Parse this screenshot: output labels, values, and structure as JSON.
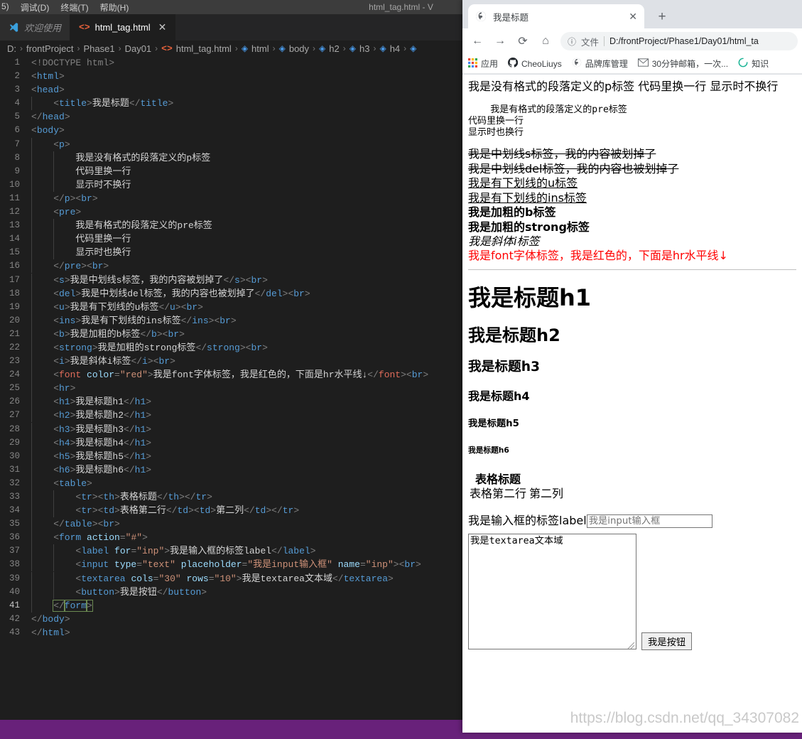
{
  "vscode": {
    "window_title": "html_tag.html - V",
    "menu": [
      "5)",
      "调试(D)",
      "终端(T)",
      "帮助(H)"
    ],
    "tabs": [
      {
        "label": "欢迎使用",
        "icon": "vscode-logo-icon",
        "active": false,
        "closable": false
      },
      {
        "label": "html_tag.html",
        "icon": "html-file-icon",
        "active": true,
        "closable": true,
        "close_glyph": "✕"
      }
    ],
    "breadcrumb": [
      {
        "label": "D:",
        "icon": ""
      },
      {
        "label": "frontProject",
        "icon": ""
      },
      {
        "label": "Phase1",
        "icon": ""
      },
      {
        "label": "Day01",
        "icon": ""
      },
      {
        "label": "html_tag.html",
        "icon": "html-tag-icon"
      },
      {
        "label": "html",
        "icon": "symbol-cube-icon"
      },
      {
        "label": "body",
        "icon": "symbol-cube-icon"
      },
      {
        "label": "h2",
        "icon": "symbol-cube-icon"
      },
      {
        "label": "h3",
        "icon": "symbol-cube-icon"
      },
      {
        "label": "h4",
        "icon": "symbol-cube-icon"
      },
      {
        "label": "",
        "icon": "symbol-cube-icon"
      }
    ],
    "code_lines": [
      {
        "n": 1,
        "indent": 0,
        "html": "<span class='punc'>&lt;!</span><span class='doctype'>DOCTYPE html</span><span class='punc'>&gt;</span>"
      },
      {
        "n": 2,
        "indent": 0,
        "html": "<span class='punc'>&lt;</span><span class='tagname'>html</span><span class='punc'>&gt;</span>"
      },
      {
        "n": 3,
        "indent": 0,
        "html": "<span class='punc'>&lt;</span><span class='tagname'>head</span><span class='punc'>&gt;</span>"
      },
      {
        "n": 4,
        "indent": 1,
        "html": "<span class='punc'>&lt;</span><span class='tagname'>title</span><span class='punc'>&gt;</span><span class='txt'>我是标题</span><span class='punc'>&lt;/</span><span class='tagname'>title</span><span class='punc'>&gt;</span>"
      },
      {
        "n": 5,
        "indent": 0,
        "html": "<span class='punc'>&lt;/</span><span class='tagname'>head</span><span class='punc'>&gt;</span>"
      },
      {
        "n": 6,
        "indent": 0,
        "html": "<span class='punc'>&lt;</span><span class='tagname'>body</span><span class='punc'>&gt;</span>"
      },
      {
        "n": 7,
        "indent": 1,
        "html": "<span class='punc'>&lt;</span><span class='tagname'>p</span><span class='punc'>&gt;</span>"
      },
      {
        "n": 8,
        "indent": 2,
        "html": "<span class='txt'>我是没有格式的段落定义的p标签</span>"
      },
      {
        "n": 9,
        "indent": 2,
        "html": "<span class='txt'>代码里换一行</span>"
      },
      {
        "n": 10,
        "indent": 2,
        "html": "<span class='txt'>显示时不换行</span>"
      },
      {
        "n": 11,
        "indent": 1,
        "html": "<span class='punc'>&lt;/</span><span class='tagname'>p</span><span class='punc'>&gt;&lt;</span><span class='tagname'>br</span><span class='punc'>&gt;</span>"
      },
      {
        "n": 12,
        "indent": 1,
        "html": "<span class='punc'>&lt;</span><span class='tagname'>pre</span><span class='punc'>&gt;</span>"
      },
      {
        "n": 13,
        "indent": 2,
        "html": "<span class='txt'>我是有格式的段落定义的pre标签</span>"
      },
      {
        "n": 14,
        "indent": 2,
        "html": "<span class='txt'>代码里换一行</span>"
      },
      {
        "n": 15,
        "indent": 2,
        "html": "<span class='txt'>显示时也换行</span>"
      },
      {
        "n": 16,
        "indent": 1,
        "html": "<span class='punc'>&lt;/</span><span class='tagname'>pre</span><span class='punc'>&gt;&lt;</span><span class='tagname'>br</span><span class='punc'>&gt;</span>"
      },
      {
        "n": 17,
        "indent": 1,
        "html": "<span class='punc'>&lt;</span><span class='tagname'>s</span><span class='punc'>&gt;</span><span class='txt'>我是中划线s标签，我的内容被划掉了</span><span class='punc'>&lt;/</span><span class='tagname'>s</span><span class='punc'>&gt;&lt;</span><span class='tagname'>br</span><span class='punc'>&gt;</span>"
      },
      {
        "n": 18,
        "indent": 1,
        "html": "<span class='punc'>&lt;</span><span class='tagname'>del</span><span class='punc'>&gt;</span><span class='txt'>我是中划线del标签，我的内容也被划掉了</span><span class='punc'>&lt;/</span><span class='tagname'>del</span><span class='punc'>&gt;&lt;</span><span class='tagname'>br</span><span class='punc'>&gt;</span>"
      },
      {
        "n": 19,
        "indent": 1,
        "html": "<span class='punc'>&lt;</span><span class='tagname'>u</span><span class='punc'>&gt;</span><span class='txt'>我是有下划线的u标签</span><span class='punc'>&lt;/</span><span class='tagname'>u</span><span class='punc'>&gt;&lt;</span><span class='tagname'>br</span><span class='punc'>&gt;</span>"
      },
      {
        "n": 20,
        "indent": 1,
        "html": "<span class='punc'>&lt;</span><span class='tagname'>ins</span><span class='punc'>&gt;</span><span class='txt'>我是有下划线的ins标签</span><span class='punc'>&lt;/</span><span class='tagname'>ins</span><span class='punc'>&gt;&lt;</span><span class='tagname'>br</span><span class='punc'>&gt;</span>"
      },
      {
        "n": 21,
        "indent": 1,
        "html": "<span class='punc'>&lt;</span><span class='tagname'>b</span><span class='punc'>&gt;</span><span class='txt'>我是加粗的b标签</span><span class='punc'>&lt;/</span><span class='tagname'>b</span><span class='punc'>&gt;&lt;</span><span class='tagname'>br</span><span class='punc'>&gt;</span>"
      },
      {
        "n": 22,
        "indent": 1,
        "html": "<span class='punc'>&lt;</span><span class='tagname'>strong</span><span class='punc'>&gt;</span><span class='txt'>我是加粗的strong标签</span><span class='punc'>&lt;/</span><span class='tagname'>strong</span><span class='punc'>&gt;&lt;</span><span class='tagname'>br</span><span class='punc'>&gt;</span>"
      },
      {
        "n": 23,
        "indent": 1,
        "html": "<span class='punc'>&lt;</span><span class='tagname'>i</span><span class='punc'>&gt;</span><span class='txt'>我是斜体i标签</span><span class='punc'>&lt;/</span><span class='tagname'>i</span><span class='punc'>&gt;&lt;</span><span class='tagname'>br</span><span class='punc'>&gt;</span>"
      },
      {
        "n": 24,
        "indent": 1,
        "html": "<span class='punc'>&lt;</span><span class='fonttag'>font</span> <span class='attr'>color</span><span class='punc'>=</span><span class='str'>\"red\"</span><span class='punc'>&gt;</span><span class='txt'>我是font字体标签，我是红色的，下面是hr水平线↓</span><span class='punc'>&lt;/</span><span class='fonttag'>font</span><span class='punc'>&gt;&lt;</span><span class='tagname'>br</span><span class='punc'>&gt;</span>"
      },
      {
        "n": 25,
        "indent": 1,
        "html": "<span class='punc'>&lt;</span><span class='tagname'>hr</span><span class='punc'>&gt;</span>"
      },
      {
        "n": 26,
        "indent": 1,
        "html": "<span class='punc'>&lt;</span><span class='tagname'>h1</span><span class='punc'>&gt;</span><span class='txt'>我是标题h1</span><span class='punc'>&lt;/</span><span class='tagname'>h1</span><span class='punc'>&gt;</span>"
      },
      {
        "n": 27,
        "indent": 1,
        "html": "<span class='punc'>&lt;</span><span class='tagname'>h2</span><span class='punc'>&gt;</span><span class='txt'>我是标题h2</span><span class='punc'>&lt;/</span><span class='tagname'>h1</span><span class='punc'>&gt;</span>"
      },
      {
        "n": 28,
        "indent": 1,
        "html": "<span class='punc'>&lt;</span><span class='tagname'>h3</span><span class='punc'>&gt;</span><span class='txt'>我是标题h3</span><span class='punc'>&lt;/</span><span class='tagname'>h1</span><span class='punc'>&gt;</span>"
      },
      {
        "n": 29,
        "indent": 1,
        "html": "<span class='punc'>&lt;</span><span class='tagname'>h4</span><span class='punc'>&gt;</span><span class='txt'>我是标题h4</span><span class='punc'>&lt;/</span><span class='tagname'>h1</span><span class='punc'>&gt;</span>"
      },
      {
        "n": 30,
        "indent": 1,
        "html": "<span class='punc'>&lt;</span><span class='tagname'>h5</span><span class='punc'>&gt;</span><span class='txt'>我是标题h5</span><span class='punc'>&lt;/</span><span class='tagname'>h1</span><span class='punc'>&gt;</span>"
      },
      {
        "n": 31,
        "indent": 1,
        "html": "<span class='punc'>&lt;</span><span class='tagname'>h6</span><span class='punc'>&gt;</span><span class='txt'>我是标题h6</span><span class='punc'>&lt;/</span><span class='tagname'>h1</span><span class='punc'>&gt;</span>"
      },
      {
        "n": 32,
        "indent": 1,
        "html": "<span class='punc'>&lt;</span><span class='tagname'>table</span><span class='punc'>&gt;</span>"
      },
      {
        "n": 33,
        "indent": 2,
        "html": "<span class='punc'>&lt;</span><span class='tagname'>tr</span><span class='punc'>&gt;&lt;</span><span class='tagname'>th</span><span class='punc'>&gt;</span><span class='txt'>表格标题</span><span class='punc'>&lt;/</span><span class='tagname'>th</span><span class='punc'>&gt;&lt;/</span><span class='tagname'>tr</span><span class='punc'>&gt;</span>"
      },
      {
        "n": 34,
        "indent": 2,
        "html": "<span class='punc'>&lt;</span><span class='tagname'>tr</span><span class='punc'>&gt;&lt;</span><span class='tagname'>td</span><span class='punc'>&gt;</span><span class='txt'>表格第二行</span><span class='punc'>&lt;/</span><span class='tagname'>td</span><span class='punc'>&gt;&lt;</span><span class='tagname'>td</span><span class='punc'>&gt;</span><span class='txt'>第二列</span><span class='punc'>&lt;/</span><span class='tagname'>td</span><span class='punc'>&gt;&lt;/</span><span class='tagname'>tr</span><span class='punc'>&gt;</span>"
      },
      {
        "n": 35,
        "indent": 1,
        "html": "<span class='punc'>&lt;/</span><span class='tagname'>table</span><span class='punc'>&gt;&lt;</span><span class='tagname'>br</span><span class='punc'>&gt;</span>"
      },
      {
        "n": 36,
        "indent": 1,
        "html": "<span class='punc'>&lt;</span><span class='tagname'>form</span> <span class='attr'>action</span><span class='punc'>=</span><span class='str'>\"#\"</span><span class='punc'>&gt;</span>"
      },
      {
        "n": 37,
        "indent": 2,
        "html": "<span class='punc'>&lt;</span><span class='tagname'>label</span> <span class='attr'>for</span><span class='punc'>=</span><span class='str'>\"inp\"</span><span class='punc'>&gt;</span><span class='txt'>我是输入框的标签label</span><span class='punc'>&lt;/</span><span class='tagname'>label</span><span class='punc'>&gt;</span>"
      },
      {
        "n": 38,
        "indent": 2,
        "html": "<span class='punc'>&lt;</span><span class='tagname'>input</span> <span class='attr'>type</span><span class='punc'>=</span><span class='str'>\"text\"</span> <span class='attr'>placeholder</span><span class='punc'>=</span><span class='str'>\"我是input输入框\"</span> <span class='attr'>name</span><span class='punc'>=</span><span class='str'>\"inp\"</span><span class='punc'>&gt;&lt;</span><span class='tagname'>br</span><span class='punc'>&gt;</span>"
      },
      {
        "n": 39,
        "indent": 2,
        "html": "<span class='punc'>&lt;</span><span class='tagname'>textarea</span> <span class='attr'>cols</span><span class='punc'>=</span><span class='str'>\"30\"</span> <span class='attr'>rows</span><span class='punc'>=</span><span class='str'>\"10\"</span><span class='punc'>&gt;</span><span class='txt'>我是textarea文本域</span><span class='punc'>&lt;/</span><span class='tagname'>textarea</span><span class='punc'>&gt;</span>"
      },
      {
        "n": 40,
        "indent": 2,
        "html": "<span class='punc'>&lt;</span><span class='tagname'>button</span><span class='punc'>&gt;</span><span class='txt'>我是按钮</span><span class='punc'>&lt;/</span><span class='tagname'>button</span><span class='punc'>&gt;</span>"
      },
      {
        "n": 41,
        "indent": 1,
        "cursor": true,
        "html": "<span class='cursor-box punc'>&lt;/</span><span class='cursor-box tagname'>form</span><span class='cursor-box punc'>&gt;</span>"
      },
      {
        "n": 42,
        "indent": 0,
        "html": "<span class='punc'>&lt;/</span><span class='tagname'>body</span><span class='punc'>&gt;</span>"
      },
      {
        "n": 43,
        "indent": 0,
        "html": "<span class='punc'>&lt;/</span><span class='tagname'>html</span><span class='punc'>&gt;</span>"
      }
    ],
    "statusbar_color": "#68217a"
  },
  "chrome": {
    "tab": {
      "title": "我是标题",
      "close_glyph": "✕",
      "favicon": "globe-icon"
    },
    "new_tab_glyph": "+",
    "nav": {
      "back_glyph": "←",
      "forward_glyph": "→",
      "reload_glyph": "⟳",
      "home_glyph": "⌂",
      "info_glyph": "ⓘ",
      "scheme_label": "文件",
      "url": "D:/frontProject/Phase1/Day01/html_ta"
    },
    "bookmarks": [
      {
        "label": "应用",
        "icon": "apps-grid-icon"
      },
      {
        "label": "CheoLiuys",
        "icon": "github-icon"
      },
      {
        "label": "品牌库管理",
        "icon": "globe-icon"
      },
      {
        "label": "30分钟邮箱，一次...",
        "icon": "mail-icon"
      },
      {
        "label": "知识",
        "icon": "loading-circle-icon"
      }
    ],
    "page": {
      "p_text": "我是没有格式的段落定义的p标签 代码里换一行 显示时不换行",
      "pre_text": "    我是有格式的段落定义的pre标签\n代码里换一行\n显示时也换行",
      "s_text": "我是中划线s标签，我的内容被划掉了",
      "del_text": "我是中划线del标签，我的内容也被划掉了",
      "u_text": "我是有下划线的u标签",
      "ins_text": "我是有下划线的ins标签",
      "b_text": "我是加粗的b标签",
      "strong_text": "我是加粗的strong标签",
      "i_text": "我是斜体i标签",
      "font_text": "我是font字体标签，我是红色的，下面是hr水平线↓",
      "font_color": "#ff0000",
      "h1": "我是标题h1",
      "h2": "我是标题h2",
      "h3": "我是标题h3",
      "h4": "我是标题h4",
      "h5": "我是标题h5",
      "h6": "我是标题h6",
      "table": {
        "header": [
          "表格标题"
        ],
        "rows": [
          [
            "表格第二行",
            "第二列"
          ]
        ]
      },
      "form": {
        "label": "我是输入框的标签label",
        "input_placeholder": "我是input输入框",
        "input_value": "",
        "textarea_value": "我是textarea文本域",
        "button_label": "我是按钮"
      }
    },
    "watermark": "https://blog.csdn.net/qq_34307082"
  }
}
